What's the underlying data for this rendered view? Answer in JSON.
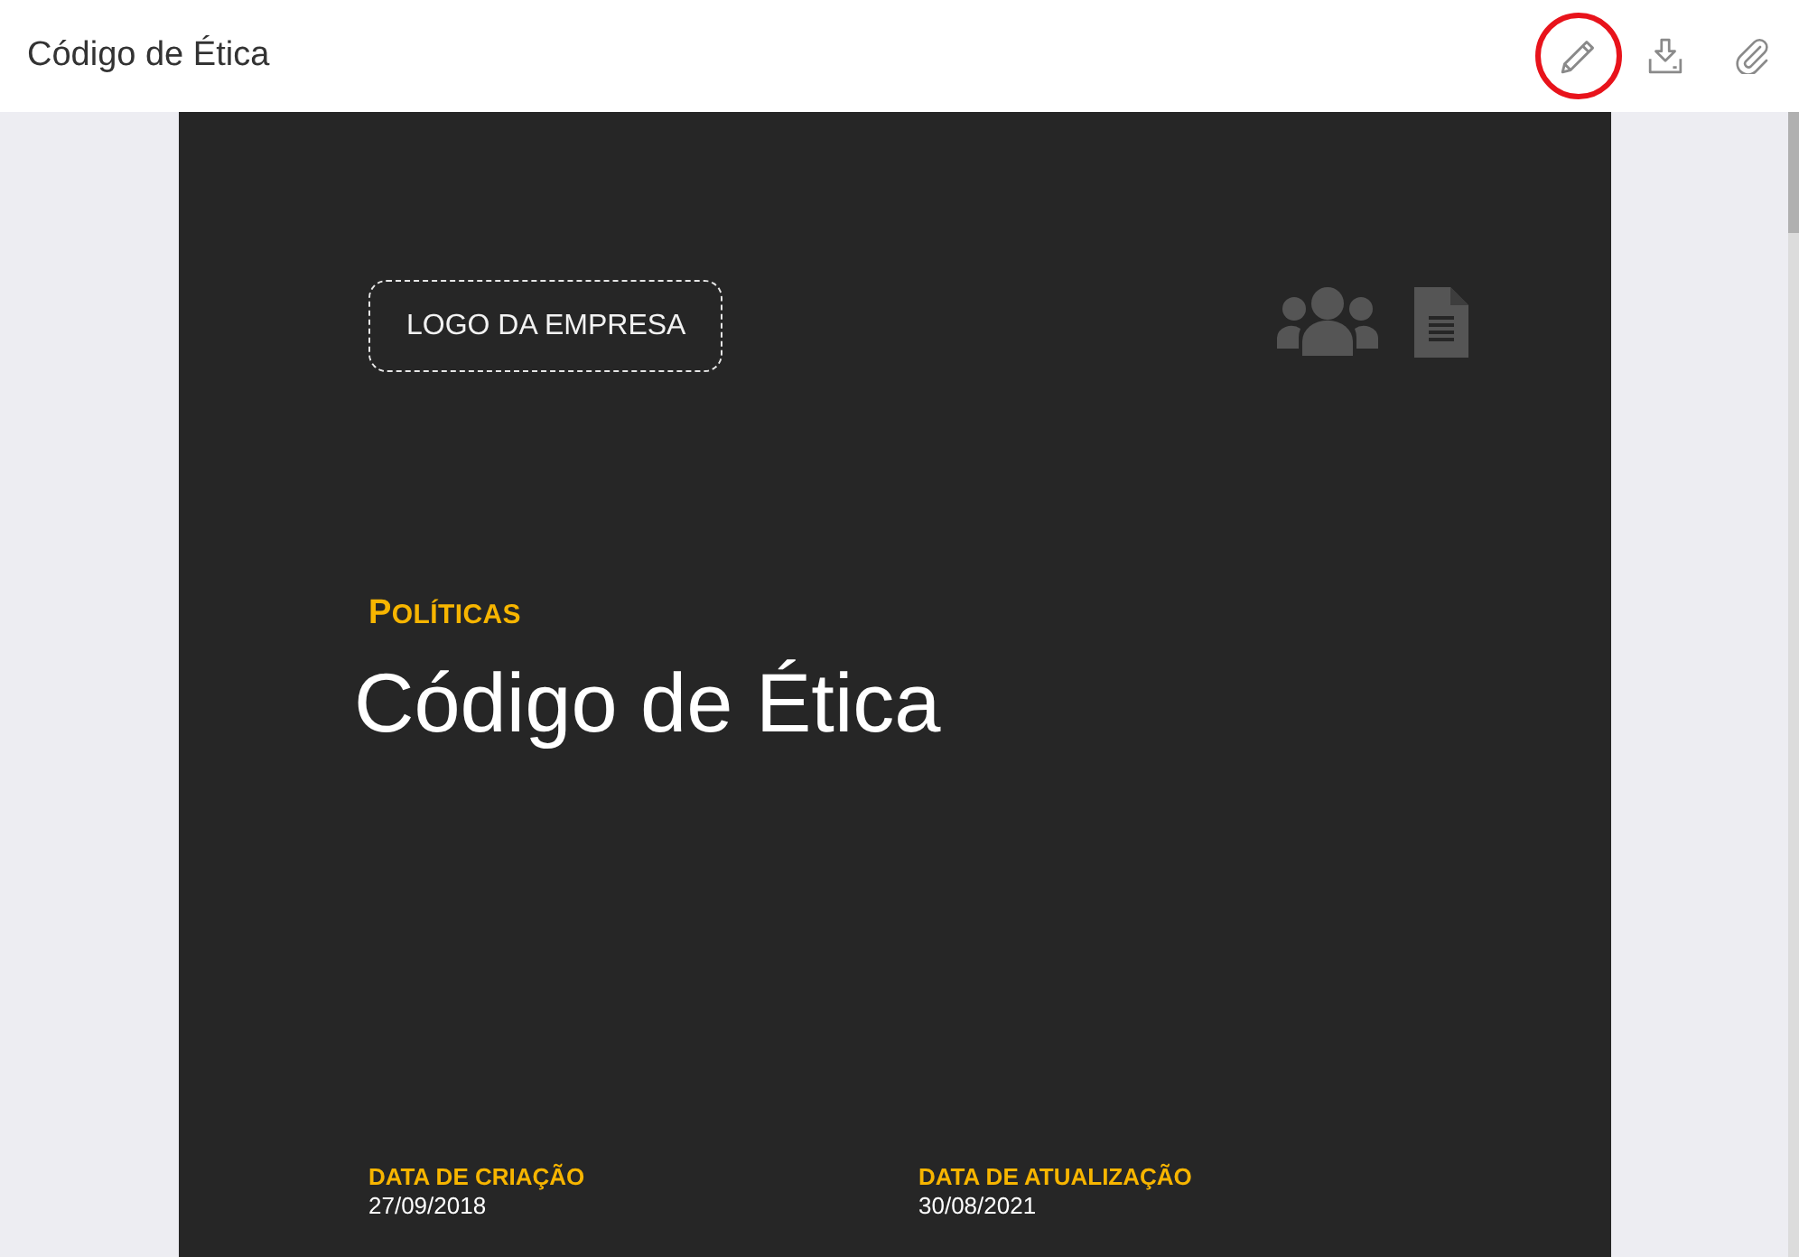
{
  "header": {
    "title": "Código de Ética",
    "actions": [
      {
        "kind": "edit",
        "highlighted": true
      },
      {
        "kind": "download",
        "highlighted": false
      },
      {
        "kind": "attach",
        "highlighted": false
      }
    ]
  },
  "document": {
    "logo_placeholder": "LOGO DA EMPRESA",
    "category": "POLÍTICAS",
    "title": "Código de Ética",
    "dates": [
      {
        "label": "DATA DE CRIAÇÃO",
        "value": "27/09/2018"
      },
      {
        "label": "DATA DE ATUALIZAÇÃO",
        "value": "30/08/2021"
      }
    ]
  }
}
